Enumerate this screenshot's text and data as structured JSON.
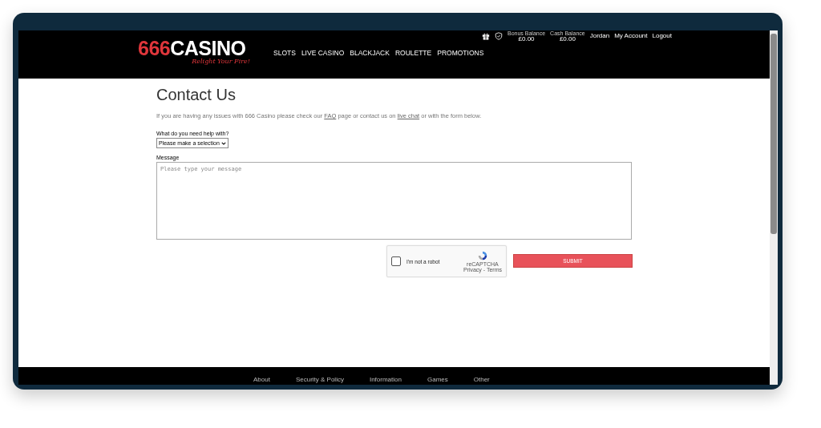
{
  "header": {
    "logo": {
      "number": "666",
      "word": "CASINO",
      "tagline": "Relight Your Fire!"
    },
    "nav": [
      "SLOTS",
      "LIVE CASINO",
      "BLACKJACK",
      "ROULETTE",
      "PROMOTIONS"
    ],
    "balances": [
      {
        "label": "Bonus Balance",
        "amount": "£0.00"
      },
      {
        "label": "Cash Balance",
        "amount": "£0.00"
      }
    ],
    "user": "Jordan",
    "links": [
      "My Account",
      "Logout"
    ]
  },
  "page": {
    "title": "Contact Us",
    "intro": {
      "before": "If you are having any issues with 666 Casino please check our ",
      "link1": "FAQ",
      "middle": " page or contact us on ",
      "link2": "live chat",
      "after": " or with the form below."
    },
    "help": {
      "label": "What do you need help with?",
      "value": "Please make a selection"
    },
    "message": {
      "label": "Message",
      "placeholder": "Please type your message"
    },
    "captcha": {
      "label": "I'm not a robot",
      "checked": false,
      "brand": "reCAPTCHA",
      "terms": "Privacy - Terms"
    },
    "submit": "SUBMIT"
  },
  "footer": {
    "columns": [
      "About",
      "Security & Policy",
      "Information",
      "Games",
      "Other"
    ]
  }
}
